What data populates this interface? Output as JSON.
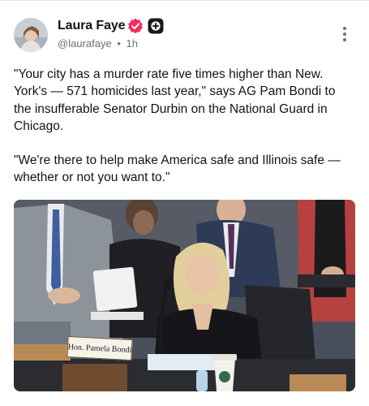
{
  "post": {
    "author_name": "Laura Faye",
    "handle": "@laurafaye",
    "separator": "•",
    "time": "1h",
    "paragraph_1": "\"Your city has a murder rate five times higher than New. York's — 571 homicides last year,\" says AG Pam Bondi to the insufferable Senator Durbin on the National Guard in Chicago.",
    "paragraph_2": "\"We're there to help make America safe and Illinois safe — whether or not you want to.\""
  },
  "media": {
    "nameplate_text": "Hon. Pamela Bondi"
  },
  "icons": {
    "verified": "verified-badge-icon",
    "plus": "plus-badge-icon",
    "more": "more-vertical-icon"
  },
  "colors": {
    "verified_badge": "#f02d5c",
    "plus_badge": "#1a1a1a",
    "muted_text": "#6b7177"
  }
}
